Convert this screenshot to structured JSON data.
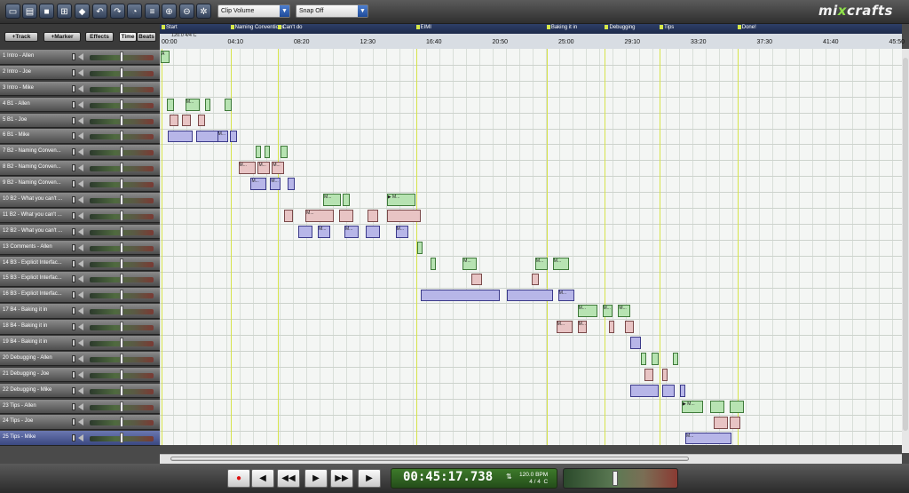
{
  "toolbar": {
    "buttons": [
      "new-file-icon",
      "open-folder-icon",
      "save-icon",
      "import-icon",
      "mixdown-icon",
      "undo-icon",
      "redo-icon",
      "metronome-icon",
      "properties-icon",
      "zoom-in-icon",
      "zoom-out-icon",
      "settings-icon"
    ],
    "clip_volume": "Clip Volume",
    "snap": "Snap Off",
    "logo_prefix": "mi",
    "logo_x": "x",
    "logo_suffix": "crafts"
  },
  "left_controls": {
    "add_track": "+Track",
    "add_marker": "+Marker",
    "effects": "Effects",
    "time": "Time",
    "beats": "Beats"
  },
  "tracks": [
    "1 Intro - Allen",
    "2 Intro - Joe",
    "3 Intro - Mike",
    "4 B1 - Allen",
    "5 B1 - Joe",
    "6 B1 - Mike",
    "7 B2 - Naming Conven...",
    "8 B2 - Naming Conven...",
    "9 B2 - Naming Conven...",
    "10 B2 - What you can't ...",
    "11 B2 - What you can't ...",
    "12 B2 - What you can't ...",
    "13 Comments - Allen",
    "14 B3 - Explicit Interfac...",
    "15 B3 - Explicit Interfac...",
    "16 B3 - Explicit Interfac...",
    "17 B4 - Baking it in",
    "18 B4 - Baking it in",
    "19 B4 - Baking it in",
    "20 Debugging - Allen",
    "21 Debugging - Joe",
    "22 Debugging - Mike",
    "23 Tips - Allen",
    "24 Tips - Joe",
    "25 Tips - Mike"
  ],
  "selected_track": 24,
  "markers": [
    "Start",
    "Naming Conventions",
    "Can't do",
    "EIMI",
    "Baking it in",
    "Debugging",
    "Tips",
    "Done!"
  ],
  "tempo_label": "120.0 4/4 C",
  "ruler": [
    "00:00",
    "04:10",
    "08:20",
    "12:30",
    "16:40",
    "20:50",
    "25:00",
    "29:10",
    "33:20",
    "37:30",
    "41:40",
    "45:50"
  ],
  "transport": {
    "time": "00:45:17.738",
    "bpm": "120.0 BPM",
    "signature": "4 / 4",
    "key": "C",
    "tap_icon": "tap-tempo-icon"
  },
  "colors": {
    "clip_green": "#b7e3b2",
    "clip_pink": "#e8c4c4",
    "clip_blue": "#b7b6e8",
    "marker_bar": "#1d2a4a",
    "clock_green": "#2f6b22",
    "marker_line": "#d6e34a"
  },
  "clips": [
    {
      "row": 0,
      "start": 0.0,
      "dur": 0.5,
      "color": "g",
      "label": "A"
    },
    {
      "row": 3,
      "start": 0.35,
      "dur": 0.4,
      "color": "g",
      "label": ""
    },
    {
      "row": 3,
      "start": 1.4,
      "dur": 0.8,
      "color": "g",
      "label": "M..."
    },
    {
      "row": 3,
      "start": 2.5,
      "dur": 0.3,
      "color": "g",
      "label": ""
    },
    {
      "row": 3,
      "start": 3.6,
      "dur": 0.4,
      "color": "g",
      "label": ""
    },
    {
      "row": 4,
      "start": 0.5,
      "dur": 0.5,
      "color": "p",
      "label": ""
    },
    {
      "row": 4,
      "start": 1.2,
      "dur": 0.5,
      "color": "p",
      "label": ""
    },
    {
      "row": 4,
      "start": 2.1,
      "dur": 0.4,
      "color": "p",
      "label": ""
    },
    {
      "row": 5,
      "start": 0.4,
      "dur": 1.4,
      "color": "b",
      "label": ""
    },
    {
      "row": 5,
      "start": 2.0,
      "dur": 1.3,
      "color": "b",
      "label": ""
    },
    {
      "row": 5,
      "start": 3.2,
      "dur": 0.6,
      "color": "b",
      "label": "M..."
    },
    {
      "row": 5,
      "start": 3.9,
      "dur": 0.4,
      "color": "b",
      "label": ""
    },
    {
      "row": 6,
      "start": 5.4,
      "dur": 0.3,
      "color": "g",
      "label": ""
    },
    {
      "row": 6,
      "start": 5.9,
      "dur": 0.3,
      "color": "g",
      "label": ""
    },
    {
      "row": 6,
      "start": 6.8,
      "dur": 0.4,
      "color": "g",
      "label": ""
    },
    {
      "row": 7,
      "start": 4.4,
      "dur": 1.0,
      "color": "p",
      "label": "M..."
    },
    {
      "row": 7,
      "start": 5.5,
      "dur": 0.7,
      "color": "p",
      "label": "M..."
    },
    {
      "row": 7,
      "start": 6.3,
      "dur": 0.7,
      "color": "p",
      "label": "M..."
    },
    {
      "row": 8,
      "start": 5.1,
      "dur": 0.9,
      "color": "b",
      "label": "M..."
    },
    {
      "row": 8,
      "start": 6.2,
      "dur": 0.6,
      "color": "b",
      "label": "M..."
    },
    {
      "row": 8,
      "start": 7.2,
      "dur": 0.4,
      "color": "b",
      "label": ""
    },
    {
      "row": 9,
      "start": 9.2,
      "dur": 1.0,
      "color": "g",
      "label": "M..."
    },
    {
      "row": 9,
      "start": 10.3,
      "dur": 0.4,
      "color": "g",
      "label": ""
    },
    {
      "row": 9,
      "start": 12.8,
      "dur": 1.6,
      "color": "g",
      "label": "▶ M..."
    },
    {
      "row": 10,
      "start": 7.0,
      "dur": 0.5,
      "color": "p",
      "label": ""
    },
    {
      "row": 10,
      "start": 8.2,
      "dur": 1.6,
      "color": "p",
      "label": "M..."
    },
    {
      "row": 10,
      "start": 10.1,
      "dur": 0.8,
      "color": "p",
      "label": ""
    },
    {
      "row": 10,
      "start": 11.7,
      "dur": 0.6,
      "color": "p",
      "label": ""
    },
    {
      "row": 10,
      "start": 12.8,
      "dur": 1.9,
      "color": "p",
      "label": ""
    },
    {
      "row": 11,
      "start": 7.8,
      "dur": 0.8,
      "color": "b",
      "label": ""
    },
    {
      "row": 11,
      "start": 8.9,
      "dur": 0.7,
      "color": "b",
      "label": "M..."
    },
    {
      "row": 11,
      "start": 10.4,
      "dur": 0.8,
      "color": "b",
      "label": "M..."
    },
    {
      "row": 11,
      "start": 11.6,
      "dur": 0.8,
      "color": "b",
      "label": ""
    },
    {
      "row": 11,
      "start": 13.3,
      "dur": 0.7,
      "color": "b",
      "label": "M..."
    },
    {
      "row": 12,
      "start": 14.5,
      "dur": 0.3,
      "color": "g",
      "label": ""
    },
    {
      "row": 13,
      "start": 15.3,
      "dur": 0.3,
      "color": "g",
      "label": ""
    },
    {
      "row": 13,
      "start": 17.1,
      "dur": 0.8,
      "color": "g",
      "label": "M..."
    },
    {
      "row": 13,
      "start": 21.2,
      "dur": 0.7,
      "color": "g",
      "label": "M..."
    },
    {
      "row": 13,
      "start": 22.2,
      "dur": 0.9,
      "color": "g",
      "label": "M..."
    },
    {
      "row": 14,
      "start": 17.6,
      "dur": 0.6,
      "color": "p",
      "label": ""
    },
    {
      "row": 14,
      "start": 21.0,
      "dur": 0.4,
      "color": "p",
      "label": ""
    },
    {
      "row": 15,
      "start": 14.7,
      "dur": 4.5,
      "color": "b",
      "label": ""
    },
    {
      "row": 15,
      "start": 19.6,
      "dur": 2.6,
      "color": "b",
      "label": ""
    },
    {
      "row": 15,
      "start": 22.5,
      "dur": 0.9,
      "color": "b",
      "label": "M..."
    },
    {
      "row": 16,
      "start": 23.6,
      "dur": 1.1,
      "color": "g",
      "label": "M..."
    },
    {
      "row": 16,
      "start": 25.0,
      "dur": 0.6,
      "color": "g",
      "label": "M..."
    },
    {
      "row": 16,
      "start": 25.9,
      "dur": 0.7,
      "color": "g",
      "label": "M..."
    },
    {
      "row": 17,
      "start": 22.4,
      "dur": 0.9,
      "color": "p",
      "label": "M..."
    },
    {
      "row": 17,
      "start": 23.6,
      "dur": 0.5,
      "color": "p",
      "label": "M..."
    },
    {
      "row": 17,
      "start": 25.4,
      "dur": 0.3,
      "color": "p",
      "label": ""
    },
    {
      "row": 17,
      "start": 26.3,
      "dur": 0.5,
      "color": "p",
      "label": ""
    },
    {
      "row": 18,
      "start": 26.6,
      "dur": 0.6,
      "color": "b",
      "label": ""
    },
    {
      "row": 19,
      "start": 27.2,
      "dur": 0.3,
      "color": "g",
      "label": ""
    },
    {
      "row": 19,
      "start": 27.8,
      "dur": 0.4,
      "color": "g",
      "label": ""
    },
    {
      "row": 19,
      "start": 29.0,
      "dur": 0.3,
      "color": "g",
      "label": ""
    },
    {
      "row": 20,
      "start": 27.4,
      "dur": 0.5,
      "color": "p",
      "label": ""
    },
    {
      "row": 20,
      "start": 28.4,
      "dur": 0.3,
      "color": "p",
      "label": ""
    },
    {
      "row": 21,
      "start": 26.6,
      "dur": 1.6,
      "color": "b",
      "label": ""
    },
    {
      "row": 21,
      "start": 28.4,
      "dur": 0.7,
      "color": "b",
      "label": ""
    },
    {
      "row": 21,
      "start": 29.4,
      "dur": 0.3,
      "color": "b",
      "label": ""
    },
    {
      "row": 22,
      "start": 29.5,
      "dur": 1.2,
      "color": "g",
      "label": "▶ M..."
    },
    {
      "row": 22,
      "start": 31.1,
      "dur": 0.8,
      "color": "g",
      "label": ""
    },
    {
      "row": 22,
      "start": 32.2,
      "dur": 0.8,
      "color": "g",
      "label": ""
    },
    {
      "row": 23,
      "start": 31.3,
      "dur": 0.8,
      "color": "p",
      "label": ""
    },
    {
      "row": 23,
      "start": 32.2,
      "dur": 0.6,
      "color": "p",
      "label": ""
    },
    {
      "row": 24,
      "start": 29.7,
      "dur": 2.6,
      "color": "b",
      "label": "M..."
    }
  ],
  "marker_lines": [
    0.0,
    3.9,
    6.6,
    14.4,
    21.8,
    25.1,
    28.2,
    32.6
  ]
}
